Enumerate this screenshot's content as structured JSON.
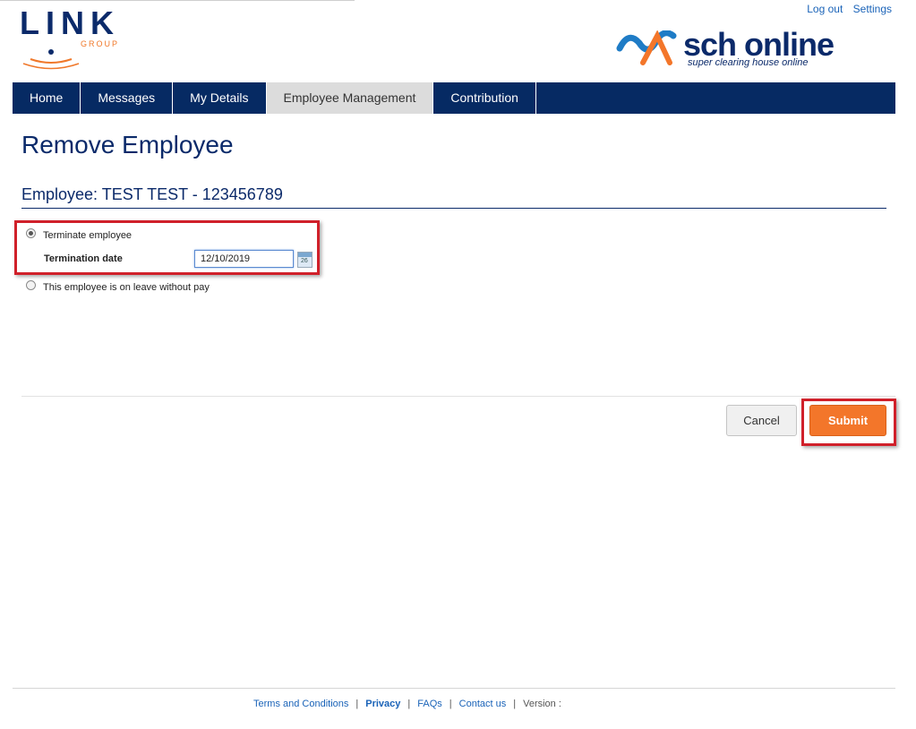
{
  "header": {
    "logo_word": "LINK",
    "logo_sub": "GROUP",
    "top_links": [
      "Log out",
      "Settings"
    ],
    "sch_title": "sch online",
    "sch_subtitle": "super clearing house online"
  },
  "nav": {
    "tabs": [
      "Home",
      "Messages",
      "My Details",
      "Employee Management",
      "Contribution"
    ],
    "active": "Employee Management"
  },
  "main": {
    "title": "Remove Employee",
    "employee_line": "Employee: TEST TEST - 123456789",
    "option_terminate": "Terminate employee",
    "termination_label": "Termination date",
    "termination_value": "12/10/2019",
    "calendar_icon_text": "26",
    "option_leave": "This employee is on leave without pay",
    "cancel_label": "Cancel",
    "submit_label": "Submit"
  },
  "footer": {
    "terms": "Terms and Conditions",
    "privacy": "Privacy",
    "faqs": "FAQs",
    "contact": "Contact us",
    "version": "Version :"
  },
  "colors": {
    "nav_bg": "#062a63",
    "brand_blue": "#0b2a6a",
    "accent_orange": "#f3762a",
    "highlight_red": "#d0202a"
  }
}
